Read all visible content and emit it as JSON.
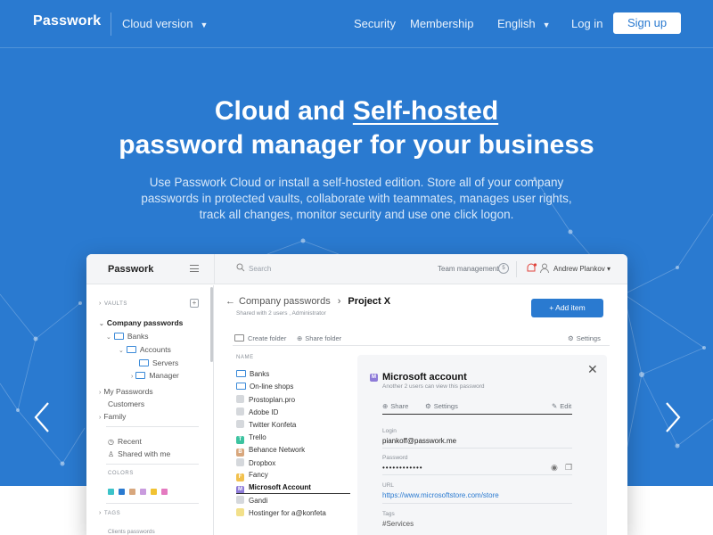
{
  "nav": {
    "logo": "Passwork",
    "version": "Cloud version",
    "links": [
      "Security",
      "Membership"
    ],
    "language": "English",
    "login": "Log in",
    "signup": "Sign up"
  },
  "hero": {
    "title_line1_a": "Cloud and ",
    "title_line1_b": "Self-hosted",
    "title_line2": "password manager for your business",
    "subtitle": "Use Passwork Cloud or install a self-hosted edition. Store all of your company passwords in protected vaults, collaborate with teammates, manages user rights, track all changes, monitor security and use one click logon."
  },
  "app": {
    "logo": "Passwork",
    "search_placeholder": "Search",
    "team_management": "Team management",
    "team_count": "5",
    "user": "Andrew Plankov ▾",
    "sidebar": {
      "vaults_label": "VAULTS",
      "company": "Company passwords",
      "folders": [
        "Banks",
        "Accounts",
        "Servers",
        "Manager"
      ],
      "others": [
        "My Passwords",
        "Customers",
        "Family"
      ],
      "recent": "Recent",
      "shared": "Shared with me",
      "colors_label": "COLORS",
      "colors": [
        "#3cc3c9",
        "#2a7ad0",
        "#d8a77d",
        "#c99bde",
        "#f1c232",
        "#e47ac0"
      ],
      "tags_label": "TAGS",
      "clients": "Clients passwords"
    },
    "main": {
      "crumb_parent": "Company passwords",
      "crumb_current": "Project X",
      "crumb_sub": "Shared with 2 users , Administrator",
      "add_item": "+ Add item",
      "create_folder": "Create folder",
      "share_folder": "Share folder",
      "settings": "Settings",
      "col_name": "NAME",
      "items": [
        {
          "label": "Banks",
          "kind": "folder",
          "letter": "",
          "color": ""
        },
        {
          "label": "On-line shops",
          "kind": "folder",
          "letter": "",
          "color": ""
        },
        {
          "label": "Prostoplan.pro",
          "kind": "badge",
          "letter": "",
          "color": "#d5d8dc"
        },
        {
          "label": "Adobe ID",
          "kind": "badge",
          "letter": "",
          "color": "#d5d8dc"
        },
        {
          "label": "Twitter Konfeta",
          "kind": "badge",
          "letter": "",
          "color": "#d5d8dc"
        },
        {
          "label": "Trello",
          "kind": "badge",
          "letter": "T",
          "color": "#3cc3a0"
        },
        {
          "label": "Behance Network",
          "kind": "badge",
          "letter": "B",
          "color": "#d8a77d"
        },
        {
          "label": "Dropbox",
          "kind": "badge",
          "letter": "",
          "color": "#d5d8dc"
        },
        {
          "label": "Fancy",
          "kind": "badge",
          "letter": "F",
          "color": "#f2c14e"
        },
        {
          "label": "Microsoft Account",
          "kind": "badge",
          "letter": "M",
          "color": "#8e7bd8"
        },
        {
          "label": "Gandi",
          "kind": "badge",
          "letter": "",
          "color": "#d5d8dc"
        },
        {
          "label": "Hostinger for a@konfeta",
          "kind": "badge",
          "letter": "",
          "color": "#f2e08a"
        }
      ]
    },
    "detail": {
      "badge": "M",
      "title": "Microsoft account",
      "subtitle": "Another 2 users can view this password",
      "share": "Share",
      "settings": "Settings",
      "edit": "Edit",
      "login_label": "Login",
      "login_value": "piankoff@passwork.me",
      "password_label": "Password",
      "password_value": "••••••••••••",
      "url_label": "URL",
      "url_value": "https://www.microsoftstore.com/store",
      "tags_label": "Tags",
      "tags_value": "#Services"
    }
  }
}
